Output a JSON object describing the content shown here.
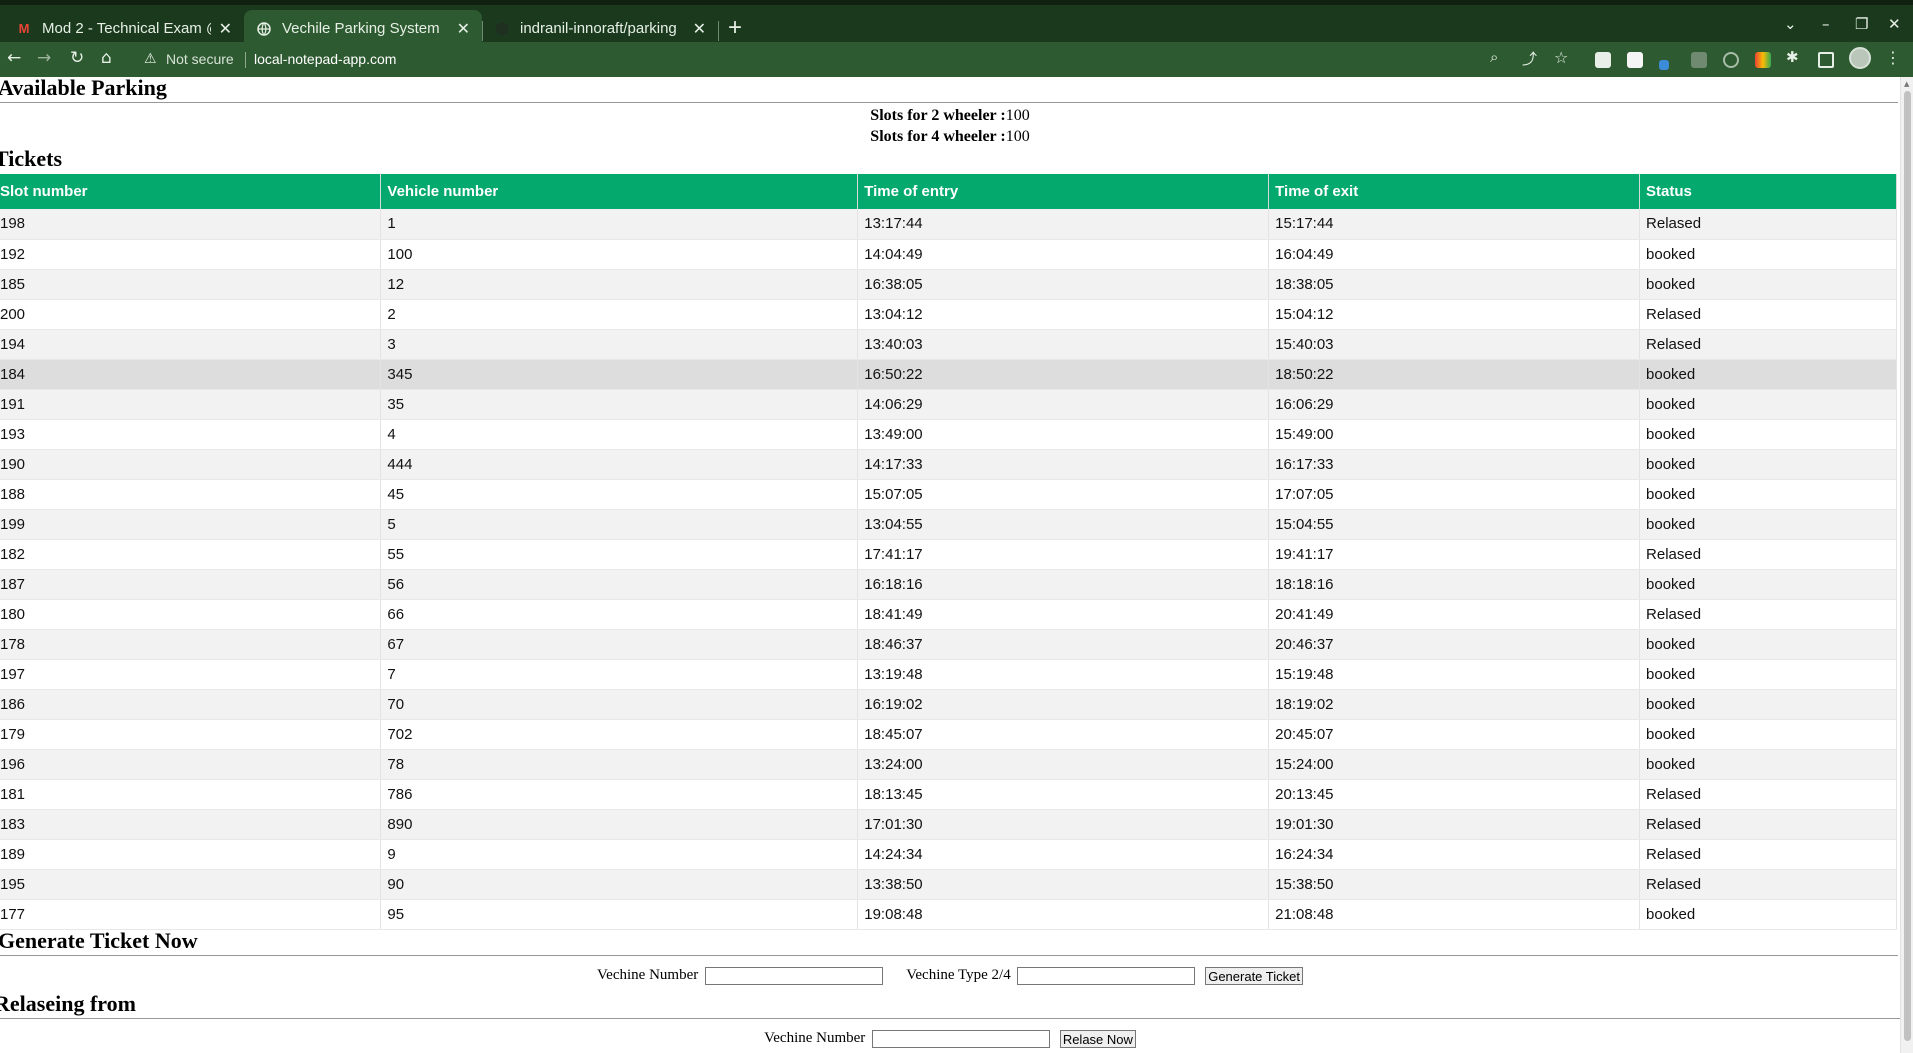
{
  "browser": {
    "tabs": [
      {
        "title": "Mod 2 - Technical Exam @",
        "icon": "gmail-icon",
        "active": false
      },
      {
        "title": "Vechile Parking System",
        "icon": "globe-icon",
        "active": true
      },
      {
        "title": "indranil-innoraft/parking",
        "icon": "github-icon",
        "active": false
      }
    ],
    "security_label": "Not secure",
    "url": "local-notepad-app.com"
  },
  "available": {
    "title": "Available Parking",
    "two_wheeler_label": "Slots for 2 wheeler :",
    "two_wheeler_value": "100",
    "four_wheeler_label": "Slots for 4 wheeler :",
    "four_wheeler_value": "100"
  },
  "tickets": {
    "title": "Tickets",
    "columns": [
      "Slot number",
      "Vehicle number",
      "Time of entry",
      "Time of exit",
      "Status"
    ],
    "rows": [
      [
        "198",
        "1",
        "13:17:44",
        "15:17:44",
        "Relased"
      ],
      [
        "192",
        "100",
        "14:04:49",
        "16:04:49",
        "booked"
      ],
      [
        "185",
        "12",
        "16:38:05",
        "18:38:05",
        "booked"
      ],
      [
        "200",
        "2",
        "13:04:12",
        "15:04:12",
        "Relased"
      ],
      [
        "194",
        "3",
        "13:40:03",
        "15:40:03",
        "Relased"
      ],
      [
        "184",
        "345",
        "16:50:22",
        "18:50:22",
        "booked"
      ],
      [
        "191",
        "35",
        "14:06:29",
        "16:06:29",
        "booked"
      ],
      [
        "193",
        "4",
        "13:49:00",
        "15:49:00",
        "booked"
      ],
      [
        "190",
        "444",
        "14:17:33",
        "16:17:33",
        "booked"
      ],
      [
        "188",
        "45",
        "15:07:05",
        "17:07:05",
        "booked"
      ],
      [
        "199",
        "5",
        "13:04:55",
        "15:04:55",
        "booked"
      ],
      [
        "182",
        "55",
        "17:41:17",
        "19:41:17",
        "Relased"
      ],
      [
        "187",
        "56",
        "16:18:16",
        "18:18:16",
        "booked"
      ],
      [
        "180",
        "66",
        "18:41:49",
        "20:41:49",
        "Relased"
      ],
      [
        "178",
        "67",
        "18:46:37",
        "20:46:37",
        "booked"
      ],
      [
        "197",
        "7",
        "13:19:48",
        "15:19:48",
        "booked"
      ],
      [
        "186",
        "70",
        "16:19:02",
        "18:19:02",
        "booked"
      ],
      [
        "179",
        "702",
        "18:45:07",
        "20:45:07",
        "booked"
      ],
      [
        "196",
        "78",
        "13:24:00",
        "15:24:00",
        "booked"
      ],
      [
        "181",
        "786",
        "18:13:45",
        "20:13:45",
        "Relased"
      ],
      [
        "183",
        "890",
        "17:01:30",
        "19:01:30",
        "Relased"
      ],
      [
        "189",
        "9",
        "14:24:34",
        "16:24:34",
        "Relased"
      ],
      [
        "195",
        "90",
        "13:38:50",
        "15:38:50",
        "Relased"
      ],
      [
        "177",
        "95",
        "19:08:48",
        "21:08:48",
        "booked"
      ]
    ]
  },
  "generate": {
    "title": "Generate Ticket Now",
    "number_label": "Vechine Number",
    "number_value": "",
    "type_label": "Vechine Type 2/4",
    "type_value": "",
    "button_label": "Generate Ticket"
  },
  "release": {
    "title": "Relaseing from",
    "number_label": "Vechine Number",
    "number_value": "",
    "button_label": "Relase Now"
  },
  "colors": {
    "header_green": "#04aa6d",
    "chrome_dark": "#1b3a1d",
    "chrome_toolbar": "#2d5a30"
  }
}
